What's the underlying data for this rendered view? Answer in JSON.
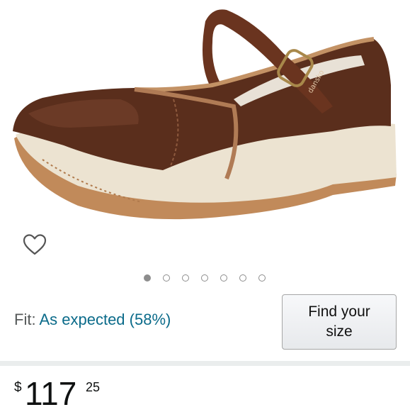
{
  "product": {
    "image_alt": "Brown leather mary jane clog with buckle strap",
    "brand_mark": "dansko"
  },
  "gallery": {
    "image_count": 7,
    "active_index": 0
  },
  "wishlist": {
    "icon": "heart-outline-icon"
  },
  "fit": {
    "label": "Fit:",
    "value": "As expected (58%)"
  },
  "find_size_button": {
    "line1": "Find your",
    "line2": "size"
  },
  "price": {
    "symbol": "$",
    "whole": "117",
    "fraction": "25"
  },
  "colors": {
    "link": "#0b6b8a",
    "text_secondary": "#565959",
    "divider": "#eaeded"
  }
}
